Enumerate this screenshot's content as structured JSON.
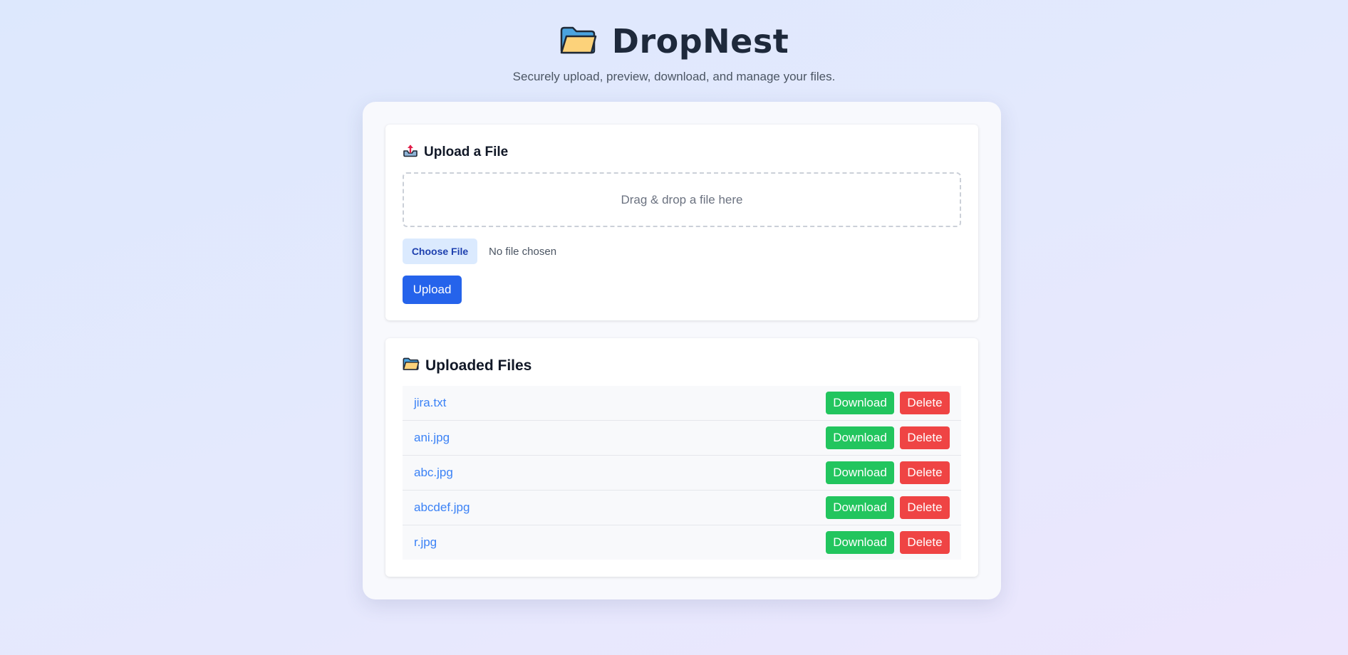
{
  "header": {
    "title": "DropNest",
    "title_icon": "folder-icon",
    "subtitle": "Securely upload, preview, download, and manage your files."
  },
  "upload": {
    "heading": "Upload a File",
    "heading_icon": "outbox-tray-icon",
    "dropzone_text": "Drag & drop a file here",
    "choose_file_label": "Choose File",
    "no_file_text": "No file chosen",
    "upload_label": "Upload"
  },
  "files": {
    "heading": "Uploaded Files",
    "heading_icon": "folder-icon",
    "download_label": "Download",
    "delete_label": "Delete",
    "items": [
      {
        "name": "jira.txt"
      },
      {
        "name": "ani.jpg"
      },
      {
        "name": "abc.jpg"
      },
      {
        "name": "abcdef.jpg"
      },
      {
        "name": "r.jpg"
      }
    ]
  },
  "colors": {
    "primary": "#2563eb",
    "download": "#22c55e",
    "delete": "#ef4444",
    "link": "#3b82f6",
    "choose_file_bg": "#dbeafe"
  }
}
